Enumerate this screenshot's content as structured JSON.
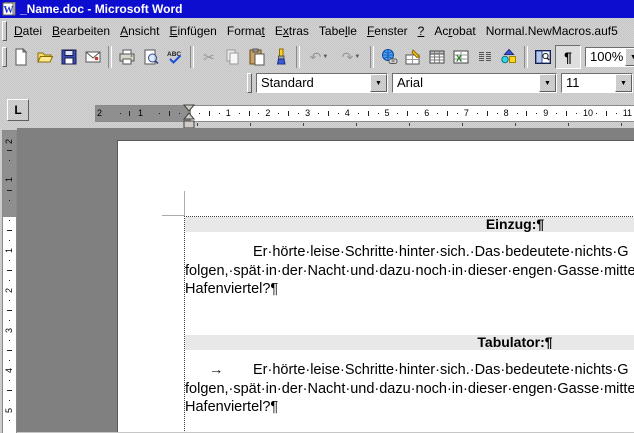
{
  "window": {
    "title": "_Name.doc - Microsoft Word"
  },
  "menu": {
    "items": [
      {
        "pre": "",
        "key": "D",
        "post": "atei"
      },
      {
        "pre": "",
        "key": "B",
        "post": "earbeiten"
      },
      {
        "pre": "",
        "key": "A",
        "post": "nsicht"
      },
      {
        "pre": "",
        "key": "E",
        "post": "infügen"
      },
      {
        "pre": "Forma",
        "key": "t",
        "post": ""
      },
      {
        "pre": "E",
        "key": "x",
        "post": "tras"
      },
      {
        "pre": "Tabe",
        "key": "l",
        "post": "le"
      },
      {
        "pre": "",
        "key": "F",
        "post": "enster"
      },
      {
        "pre": "",
        "key": "?",
        "post": ""
      },
      {
        "pre": "Ac",
        "key": "r",
        "post": "obat"
      },
      {
        "pre": "Normal.NewMacros.auf5",
        "key": "",
        "post": ""
      }
    ]
  },
  "toolbar_standard": {
    "zoom_value": "100%"
  },
  "toolbar_formatting": {
    "style_value": "Standard",
    "font_value": "Arial",
    "size_value": "11"
  },
  "icons": {
    "cut": "✂",
    "undo": "↶",
    "redo": "↷",
    "pilcrow": "¶",
    "help": "?",
    "dropdown": "▼",
    "spelling_text": "ABC",
    "tab_selector": "L"
  },
  "ruler": {
    "h_margin_numbers": [
      "2",
      "1"
    ],
    "h_numbers": [
      "1",
      "2",
      "3",
      "4",
      "5",
      "6",
      "7",
      "8",
      "9",
      "10",
      "11"
    ],
    "v_margin_numbers": [
      "2",
      "1"
    ],
    "v_numbers": [
      "1",
      "2",
      "3",
      "4",
      "5"
    ]
  },
  "document": {
    "sections": [
      {
        "heading": "Einzug:¶",
        "lines": [
          "Er·hörte·leise·Schritte·hinter·sich.·Das·bedeutete·nichts·G",
          "folgen,·spät·in·der·Nacht·und·dazu·noch·in·dieser·engen·Gasse·mitte",
          "Hafenviertel?¶"
        ]
      },
      {
        "heading": "Tabulator:¶",
        "tab_mark": "→",
        "lines": [
          "Er·hörte·leise·Schritte·hinter·sich.·Das·bedeutete·nichts·G",
          "folgen,·spät·in·der·Nacht·und·dazu·noch·in·dieser·engen·Gasse·mitte",
          "Hafenviertel?¶"
        ]
      }
    ]
  },
  "colors": {
    "title_bar": "#0d0dcf",
    "workspace_grey": "#808080",
    "heading_shading": "#e8e8e8",
    "ruler_margin_grey": "#8f8f8f"
  }
}
